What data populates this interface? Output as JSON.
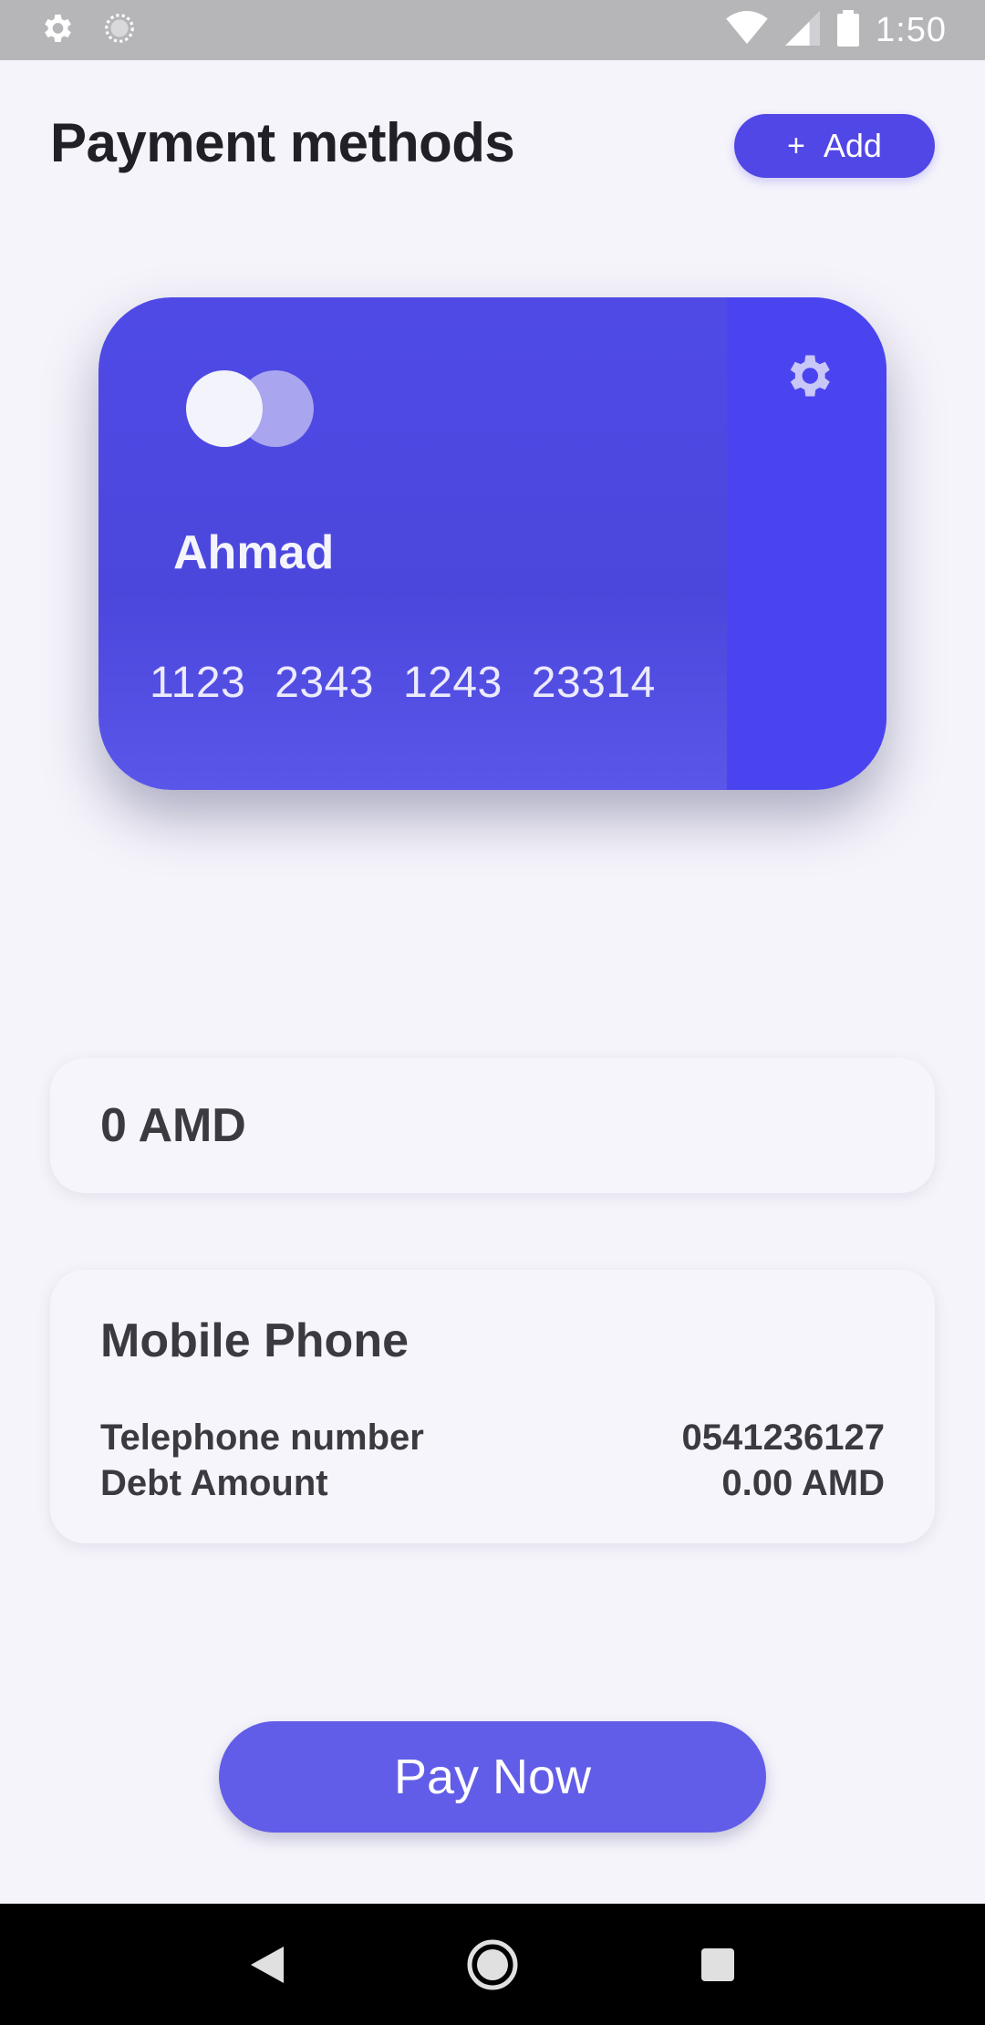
{
  "status_bar": {
    "time": "1:50",
    "icons": [
      "gear-icon",
      "sync-icon",
      "wifi-icon",
      "signal-icon",
      "battery-icon"
    ]
  },
  "header": {
    "title": "Payment methods",
    "add_button": {
      "icon": "+",
      "label": "Add"
    }
  },
  "card": {
    "holder": "Ahmad",
    "number_groups": [
      "1123",
      "2343",
      "1243",
      "23314"
    ],
    "settings_icon": "gear-icon",
    "color": "#4f4ae6"
  },
  "balance": {
    "text": "0 AMD"
  },
  "mobile_phone": {
    "title": "Mobile Phone",
    "rows": [
      {
        "label": "Telephone number",
        "value": "0541236127"
      },
      {
        "label": "Debt Amount",
        "value": "0.00 AMD"
      }
    ]
  },
  "pay_button": {
    "label": "Pay Now"
  },
  "nav_bar": {
    "icons": [
      "back-icon",
      "home-icon",
      "recents-icon"
    ]
  },
  "colors": {
    "accent": "#5147e6",
    "background": "#f5f4fb",
    "text_dark": "#3a3a40"
  }
}
